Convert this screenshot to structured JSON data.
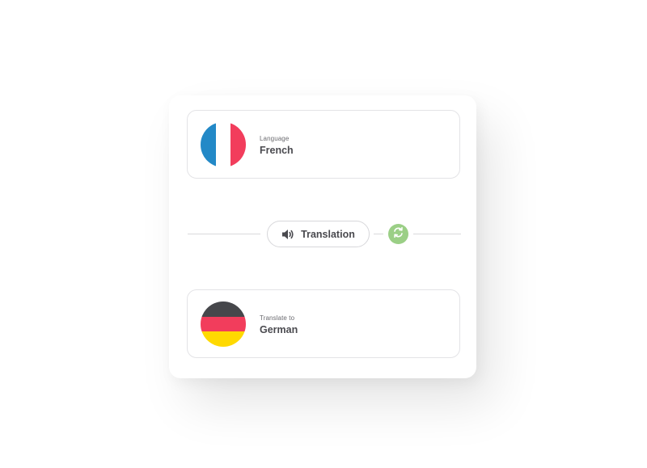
{
  "source": {
    "caption": "Language",
    "value": "French",
    "flag_icon": "france-flag-icon",
    "flag_colors": [
      "#2389c7",
      "#ffffff",
      "#f23d5c"
    ]
  },
  "target": {
    "caption": "Translate to",
    "value": "German",
    "flag_icon": "germany-flag-icon",
    "flag_colors": [
      "#46474b",
      "#f23d5c",
      "#ffd900"
    ]
  },
  "controls": {
    "translate_label": "Translation",
    "translate_icon": "speaker-icon",
    "swap_icon": "swap-arrows-icon",
    "swap_color": "#9bcf86"
  }
}
